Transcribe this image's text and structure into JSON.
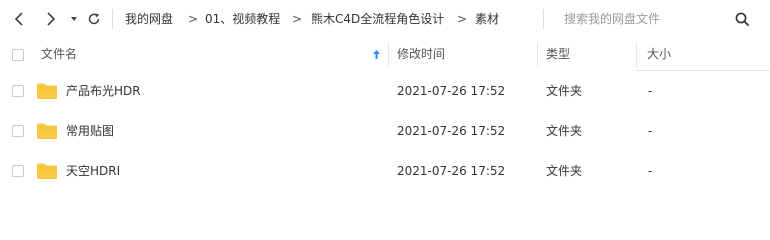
{
  "toolbar": {
    "back_icon": "chevron-left-icon",
    "forward_icon": "chevron-right-icon",
    "dropdown_icon": "caret-down-icon",
    "refresh_icon": "refresh-icon",
    "breadcrumb": [
      "我的网盘",
      "01、视频教程",
      "熊木C4D全流程角色设计",
      "素材"
    ],
    "breadcrumb_separator": ">",
    "search_placeholder": "搜索我的网盘文件",
    "search_icon": "search-icon"
  },
  "table": {
    "columns": {
      "name": "文件名",
      "modified": "修改时间",
      "type": "类型",
      "size": "大小"
    },
    "sort_icon": "sort-up-arrow-icon",
    "rows": [
      {
        "name": "产品布光HDR",
        "modified": "2021-07-26 17:52",
        "type": "文件夹",
        "size": "-"
      },
      {
        "name": "常用贴图",
        "modified": "2021-07-26 17:52",
        "type": "文件夹",
        "size": "-"
      },
      {
        "name": "天空HDRI",
        "modified": "2021-07-26 17:52",
        "type": "文件夹",
        "size": "-"
      }
    ]
  },
  "colors": {
    "folder": "#f7c945",
    "sort_arrow": "#2b8ef3",
    "header_bg": "#ffffff",
    "text": "#333333"
  }
}
